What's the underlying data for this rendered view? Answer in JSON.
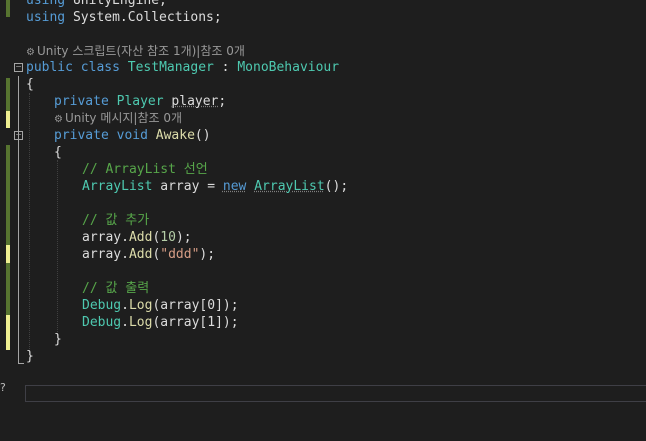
{
  "editor": {
    "lines": {
      "l1": {
        "kw": "using",
        "ns": "UnityEngine;"
      },
      "l2": {
        "kw": "using",
        "ns": "System.Collections;"
      },
      "codelens_class": "Unity 스크립트(자산 참조 1개)|참조 0개",
      "class_decl": {
        "kw1": "public",
        "kw2": "class",
        "name": "TestManager",
        "colon": " : ",
        "base": "MonoBehaviour"
      },
      "open_brace": "{",
      "field": {
        "kw": "private",
        "type": "Player",
        "name": "player",
        "semi": ";"
      },
      "codelens_method": "Unity 메시지|참조 0개",
      "method_decl": {
        "kw1": "private",
        "kw2": "void",
        "name": "Awake",
        "parens": "()"
      },
      "method_open": "{",
      "comment1": "// ArrayList 선언",
      "decl": {
        "type": "ArrayList",
        "var": "array",
        "eq": " = ",
        "new": "new",
        "ctor": "ArrayList",
        "tail": "();"
      },
      "comment2": "// 값 추가",
      "add1": {
        "obj": "array",
        "dot": ".",
        "method": "Add",
        "open": "(",
        "arg": "10",
        "close": ");"
      },
      "add2": {
        "obj": "array",
        "dot": ".",
        "method": "Add",
        "open": "(",
        "arg": "\"ddd\"",
        "close": ");"
      },
      "comment3": "// 값 출력",
      "log1": {
        "cls": "Debug",
        "dot": ".",
        "method": "Log",
        "args": "(array[0]);"
      },
      "log2": {
        "cls": "Debug",
        "dot": ".",
        "method": "Log",
        "args": "(array[1]);"
      },
      "method_close": "}",
      "class_close": "}"
    },
    "fold_minus": "−",
    "side_mark": "?"
  },
  "colors": {
    "background": "#1e1e1e",
    "keyword": "#569cd6",
    "type": "#4ec9b0",
    "comment": "#57a64a",
    "string": "#d69d85",
    "number": "#b5cea8",
    "method": "#dcdcaa",
    "saved_change": "#577430",
    "unsaved_change": "#efef91"
  }
}
